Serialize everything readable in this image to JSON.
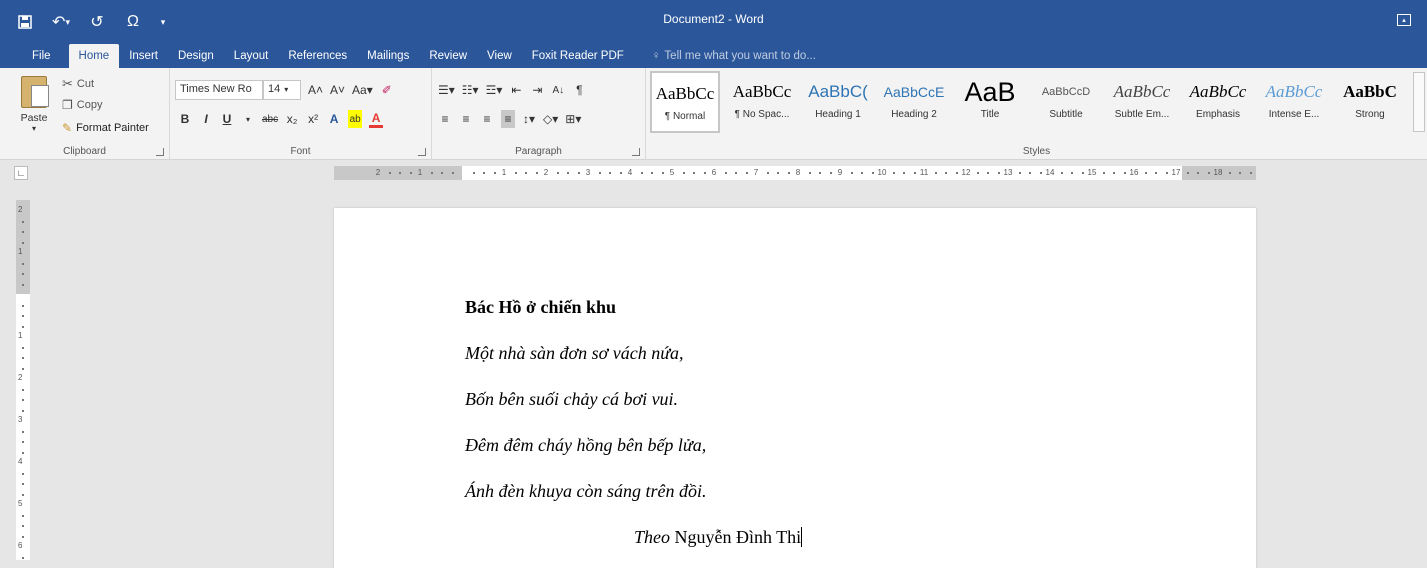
{
  "window": {
    "title": "Document2 - Word"
  },
  "qat": {
    "save_icon": "save-icon",
    "undo": "↶",
    "undo_arrow": "▾",
    "redo": "↺",
    "omega": "Ω",
    "more": "▾"
  },
  "tabs": [
    {
      "label": "File"
    },
    {
      "label": "Home"
    },
    {
      "label": "Insert"
    },
    {
      "label": "Design"
    },
    {
      "label": "Layout"
    },
    {
      "label": "References"
    },
    {
      "label": "Mailings"
    },
    {
      "label": "Review"
    },
    {
      "label": "View"
    },
    {
      "label": "Foxit Reader PDF"
    }
  ],
  "tell_me": "Tell me what you want to do...",
  "clipboard": {
    "paste": "Paste",
    "cut": "Cut",
    "copy": "Copy",
    "format_painter": "Format Painter",
    "label": "Clipboard"
  },
  "font": {
    "name": "Times New Ro",
    "size": "14",
    "label": "Font",
    "grow": "A˄",
    "shrink": "A˅",
    "case": "Aa▾",
    "bold": "B",
    "italic": "I",
    "underline": "U",
    "strike": "abc",
    "sub": "x₂",
    "sup": "x²",
    "effects": "A",
    "highlight": "ab",
    "color": "A"
  },
  "paragraph": {
    "label": "Paragraph",
    "pilcrow": "¶",
    "sort": "A↓"
  },
  "styles": {
    "label": "Styles",
    "items": [
      {
        "preview": "AaBbCc",
        "name": "¶ Normal"
      },
      {
        "preview": "AaBbCc",
        "name": "¶ No Spac..."
      },
      {
        "preview": "AaBbC(",
        "name": "Heading 1"
      },
      {
        "preview": "AaBbCcE",
        "name": "Heading 2"
      },
      {
        "preview": "AaB",
        "name": "Title"
      },
      {
        "preview": "AaBbCcD",
        "name": "Subtitle"
      },
      {
        "preview": "AaBbCc",
        "name": "Subtle Em..."
      },
      {
        "preview": "AaBbCc",
        "name": "Emphasis"
      },
      {
        "preview": "AaBbCc",
        "name": "Intense E..."
      },
      {
        "preview": "AaBbC",
        "name": "Strong"
      }
    ]
  },
  "colors": {
    "accent": "#2b579a",
    "highlight": "#ffff00",
    "font_red": "#e53935",
    "heading_blue": "#2e74b5",
    "intense_blue": "#5b9bd5"
  },
  "document": {
    "title": "Bác Hồ ở chiến khu",
    "lines": [
      "Một nhà sàn đơn sơ vách nứa,",
      "Bốn bên suối chảy cá bơi vui.",
      "Đêm đêm cháy hồng bên bếp lửa,",
      "Ánh đèn khuya còn sáng trên đồi."
    ],
    "attribution_prefix": "Theo",
    "attribution_author": "Nguyễn Đình Thi"
  }
}
